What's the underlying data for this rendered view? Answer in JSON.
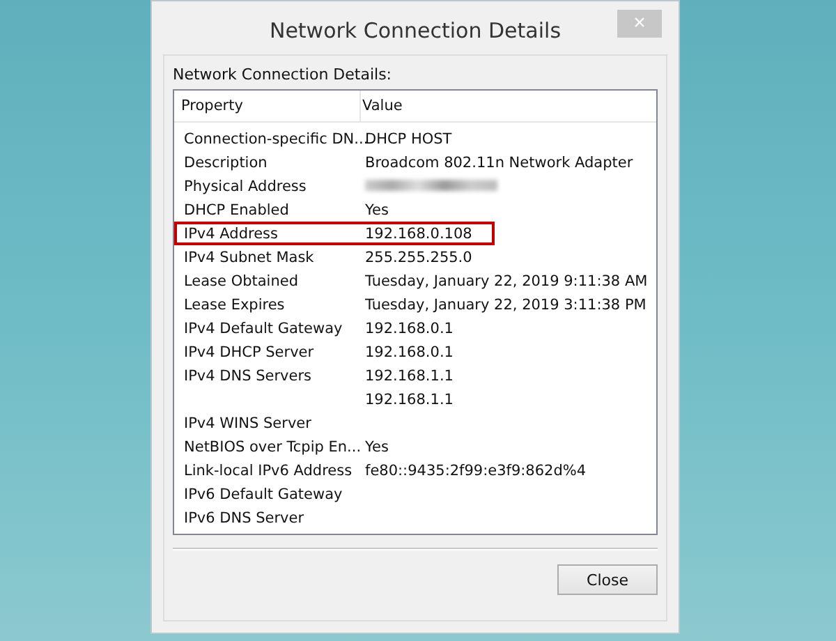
{
  "window": {
    "title": "Network Connection Details",
    "close_glyph": "×"
  },
  "group_label": "Network Connection Details:",
  "table": {
    "columns": [
      "Property",
      "Value"
    ],
    "rows": [
      {
        "property": "Connection-specific DN...",
        "value": "DHCP HOST",
        "highlighted": false
      },
      {
        "property": "Description",
        "value": "Broadcom 802.11n Network Adapter",
        "highlighted": false
      },
      {
        "property": "Physical Address",
        "kind": "blurred",
        "highlighted": false
      },
      {
        "property": "DHCP Enabled",
        "value": "Yes",
        "highlighted": false
      },
      {
        "property": "IPv4 Address",
        "value": "192.168.0.108",
        "highlighted": true
      },
      {
        "property": "IPv4 Subnet Mask",
        "value": "255.255.255.0",
        "highlighted": false
      },
      {
        "property": "Lease Obtained",
        "value": "Tuesday, January 22, 2019 9:11:38 AM",
        "highlighted": false
      },
      {
        "property": "Lease Expires",
        "value": "Tuesday, January 22, 2019 3:11:38 PM",
        "highlighted": false
      },
      {
        "property": "IPv4 Default Gateway",
        "value": "192.168.0.1",
        "highlighted": false
      },
      {
        "property": "IPv4 DHCP Server",
        "value": "192.168.0.1",
        "highlighted": false
      },
      {
        "property": "IPv4 DNS Servers",
        "value": "192.168.1.1",
        "highlighted": false
      },
      {
        "value": "192.168.1.1",
        "highlighted": false
      },
      {
        "property": "IPv4 WINS Server",
        "highlighted": false
      },
      {
        "property": "NetBIOS over Tcpip En...",
        "value": "Yes",
        "highlighted": false
      },
      {
        "property": "Link-local IPv6 Address",
        "value": "fe80::9435:2f99:e3f9:862d%4",
        "highlighted": false
      },
      {
        "property": "IPv6 Default Gateway",
        "highlighted": false
      },
      {
        "property": "IPv6 DNS Server",
        "highlighted": false
      }
    ]
  },
  "buttons": [
    "Close"
  ]
}
